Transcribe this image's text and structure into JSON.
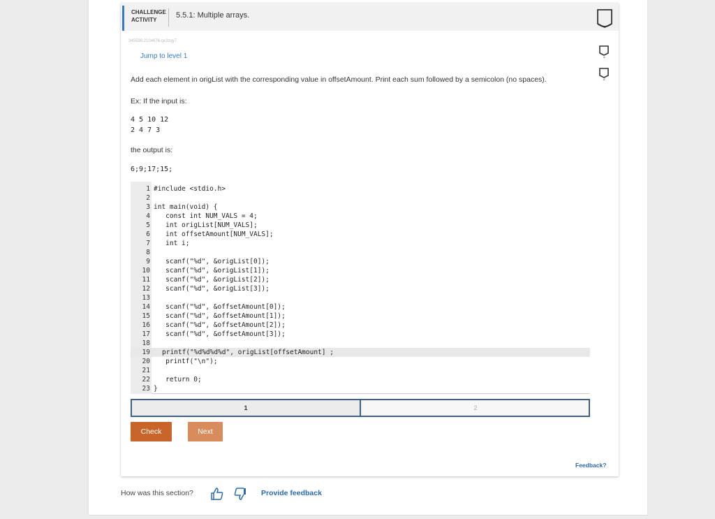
{
  "header": {
    "activity_label": "CHALLENGE ACTIVITY",
    "title": "5.5.1: Multiple arrays."
  },
  "seed": "345598.2104676.qx3zqy7",
  "jump_link": "Jump to level 1",
  "level_nav": [
    {
      "label": "1"
    },
    {
      "label": "2"
    }
  ],
  "prompt": "Add each element in origList with the corresponding value in offsetAmount. Print each sum followed by a semicolon (no spaces).",
  "example_intro": "Ex: If the input is:",
  "example_input": [
    "4  5  10  12",
    "2  4  7  3"
  ],
  "output_intro": "the output is:",
  "example_output": "6;9;17;15;",
  "code_lines": [
    {
      "n": "1",
      "text": "#include <stdio.h>"
    },
    {
      "n": "2",
      "text": ""
    },
    {
      "n": "3",
      "text": "int main(void) {"
    },
    {
      "n": "4",
      "text": "   const int NUM_VALS = 4;"
    },
    {
      "n": "5",
      "text": "   int origList[NUM_VALS];"
    },
    {
      "n": "6",
      "text": "   int offsetAmount[NUM_VALS];"
    },
    {
      "n": "7",
      "text": "   int i;"
    },
    {
      "n": "8",
      "text": ""
    },
    {
      "n": "9",
      "text": "   scanf(\"%d\", &origList[0]);"
    },
    {
      "n": "10",
      "text": "   scanf(\"%d\", &origList[1]);"
    },
    {
      "n": "11",
      "text": "   scanf(\"%d\", &origList[2]);"
    },
    {
      "n": "12",
      "text": "   scanf(\"%d\", &origList[3]);"
    },
    {
      "n": "13",
      "text": ""
    },
    {
      "n": "14",
      "text": "   scanf(\"%d\", &offsetAmount[0]);"
    },
    {
      "n": "15",
      "text": "   scanf(\"%d\", &offsetAmount[1]);"
    },
    {
      "n": "16",
      "text": "   scanf(\"%d\", &offsetAmount[2]);"
    },
    {
      "n": "17",
      "text": "   scanf(\"%d\", &offsetAmount[3]);"
    },
    {
      "n": "18",
      "text": ""
    },
    {
      "n": "19",
      "text": "printf(\"%d%d%d%d\", origList[offsetAmount] ;",
      "active": true
    },
    {
      "n": "20",
      "text": "   printf(\"\\n\");"
    },
    {
      "n": "21",
      "text": ""
    },
    {
      "n": "22",
      "text": "   return 0;"
    },
    {
      "n": "23",
      "text": "}"
    }
  ],
  "test_tabs": [
    {
      "label": "1",
      "state": "active"
    },
    {
      "label": "2",
      "state": "inactive"
    }
  ],
  "buttons": {
    "check": "Check",
    "next": "Next"
  },
  "feedback_link": "Feedback?",
  "footer": {
    "question": "How was this section?",
    "provide_feedback": "Provide feedback"
  },
  "colors": {
    "accent_blue": "#3a7abf",
    "check_button": "#c8652a",
    "next_button": "#d88c5c",
    "tab_border": "#3d5f8a"
  }
}
